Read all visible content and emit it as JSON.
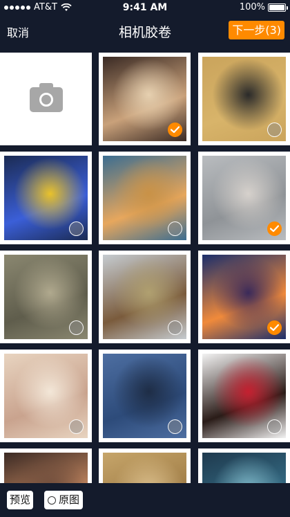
{
  "status_bar": {
    "carrier": "AT&T",
    "time": "9:41 AM",
    "battery": "100%"
  },
  "nav": {
    "cancel": "取消",
    "title": "相机胶卷",
    "next": "下一步(3)"
  },
  "grid": {
    "camera_icon": "camera-icon",
    "photos": [
      {
        "id": 1,
        "subject": "portrait-woman",
        "selected": true,
        "colors": [
          "#3a2a24",
          "#c9a17a",
          "#e6d0b0"
        ]
      },
      {
        "id": 2,
        "subject": "zebras",
        "selected": false,
        "colors": [
          "#caa45c",
          "#d8b46a",
          "#2a2a2a"
        ]
      },
      {
        "id": 3,
        "subject": "blue-flower",
        "selected": false,
        "colors": [
          "#1b2b53",
          "#3b5fd8",
          "#e9c22b"
        ]
      },
      {
        "id": 4,
        "subject": "sunset-road",
        "selected": false,
        "colors": [
          "#3b6d91",
          "#e7a75d",
          "#c99247"
        ]
      },
      {
        "id": 5,
        "subject": "child-with-hat",
        "selected": true,
        "colors": [
          "#b9bcbf",
          "#8f9397",
          "#d6d1cc"
        ]
      },
      {
        "id": 6,
        "subject": "lion-paw",
        "selected": false,
        "colors": [
          "#8a8770",
          "#5f5d4c",
          "#b0a98e"
        ]
      },
      {
        "id": 7,
        "subject": "wine-cheese-table",
        "selected": false,
        "colors": [
          "#c5cbd0",
          "#7a5b3c",
          "#b0a070"
        ]
      },
      {
        "id": 8,
        "subject": "fishing-net-sunset",
        "selected": true,
        "colors": [
          "#1b2e6b",
          "#f08a3b",
          "#3a2a5a"
        ]
      },
      {
        "id": 9,
        "subject": "flower-petals-tunnel",
        "selected": false,
        "colors": [
          "#e8d4c0",
          "#c9a38e",
          "#f3e7d8"
        ]
      },
      {
        "id": 10,
        "subject": "woman-on-rock",
        "selected": false,
        "colors": [
          "#4d6ea1",
          "#2d4b7a",
          "#1e2d46"
        ]
      },
      {
        "id": 11,
        "subject": "woman-with-rose",
        "selected": false,
        "colors": [
          "#f2f2f2",
          "#2a1c18",
          "#c52030"
        ]
      },
      {
        "id": 12,
        "subject": "woman-portrait",
        "selected": false,
        "colors": [
          "#3b2a24",
          "#c88a62",
          "#6b4a3a"
        ]
      },
      {
        "id": 13,
        "subject": "antelopes",
        "selected": false,
        "colors": [
          "#c6a56a",
          "#9e7b45",
          "#dcc08d"
        ]
      },
      {
        "id": 14,
        "subject": "blue-creature",
        "selected": false,
        "colors": [
          "#1f3a4e",
          "#356d86",
          "#7fb8c8"
        ]
      }
    ]
  },
  "bottom": {
    "preview": "预览",
    "original": "原图"
  },
  "colors": {
    "background": "#141b2c",
    "accent": "#ff8a00",
    "cell": "#ffffff",
    "camera": "#a7a7a7"
  }
}
